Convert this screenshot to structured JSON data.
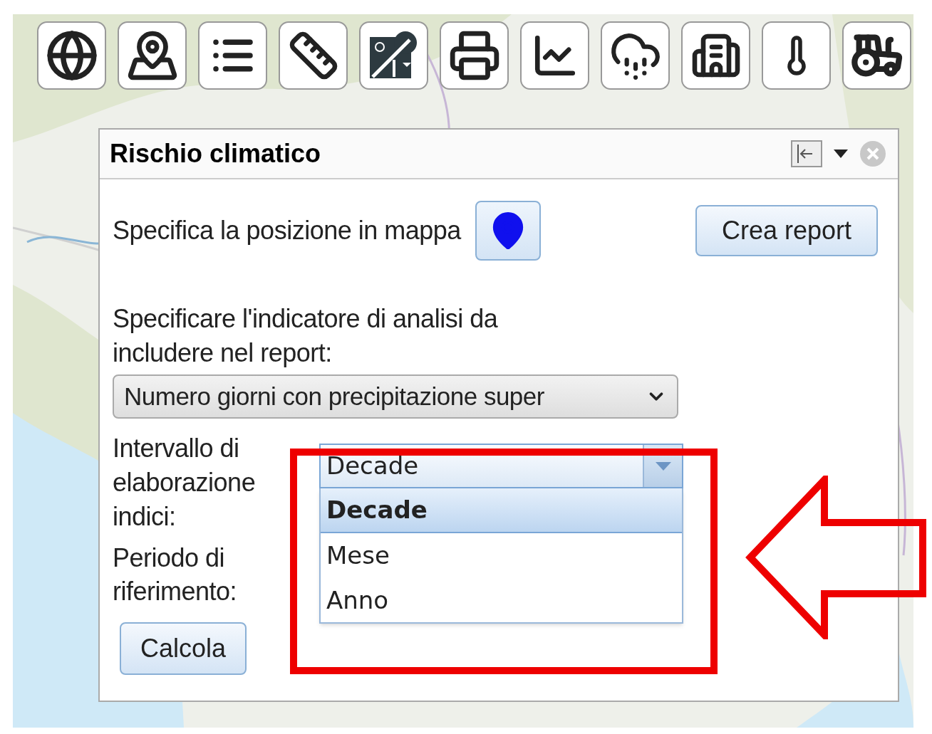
{
  "panel": {
    "title": "Rischio climatico",
    "location_label": "Specifica la posizione in mappa",
    "report_button": "Crea report",
    "indicator_label": "Specificare l'indicatore di analisi da includere nel report:",
    "indicator_select": {
      "value": "Numero giorni con precipitazione super"
    },
    "interval_label": "Intervallo di elaborazione indici:",
    "interval_combo": {
      "value": "Decade",
      "expanded": true,
      "options": [
        {
          "label": "Decade",
          "selected": true
        },
        {
          "label": "Mese",
          "selected": false
        },
        {
          "label": "Anno",
          "selected": false
        }
      ]
    },
    "period_label": "Periodo di riferimento:",
    "calculate_button": "Calcola"
  }
}
